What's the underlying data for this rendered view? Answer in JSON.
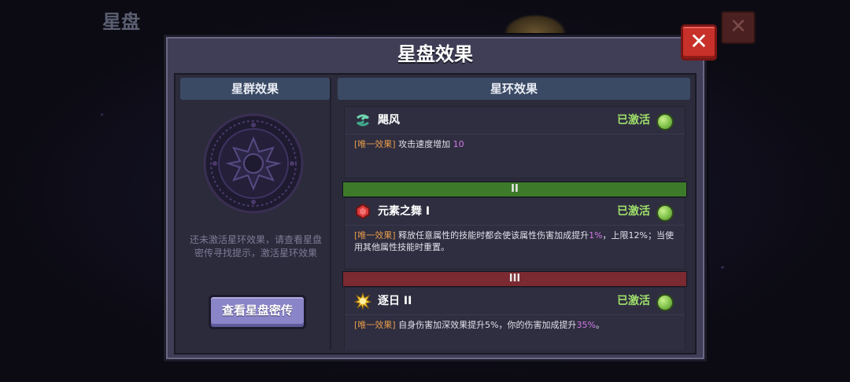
{
  "background": {
    "title": "星盘"
  },
  "modal": {
    "title": "星盘效果",
    "close_label": "✕"
  },
  "left": {
    "header": "星群效果",
    "hint": "还未激活星环效果，请查看星盘密传寻找提示，激活星环效果",
    "button": "查看星盘密传"
  },
  "right": {
    "header": "星环效果",
    "rings": [
      {
        "icon": "whirlwind-icon",
        "name": "飓风",
        "status": "已激活",
        "tag": "[唯一效果]",
        "desc_parts": [
          "攻击速度增加 ",
          "10",
          ""
        ]
      },
      {
        "icon": "red-gem-icon",
        "name": "元素之舞 I",
        "status": "已激活",
        "tag": "[唯一效果]",
        "desc_parts": [
          "释放任意属性的技能时都会使该属性伤害加成提升",
          "1%",
          "，上限12%；当使用其他属性技能时重置。"
        ]
      },
      {
        "icon": "sun-icon",
        "name": "逐日 II",
        "status": "已激活",
        "tag": "[唯一效果]",
        "desc_parts": [
          "自身伤害加深效果提升5%，你的伤害加成提升",
          "35%",
          "。"
        ]
      }
    ],
    "tiers": [
      "II",
      "III"
    ]
  },
  "colors": {
    "active_green": "#9fe06a",
    "tag_orange": "#e59a4a",
    "highlight_purple": "#d27ae8",
    "tier_green": "#3d7a2a",
    "tier_red": "#7a2a30"
  }
}
